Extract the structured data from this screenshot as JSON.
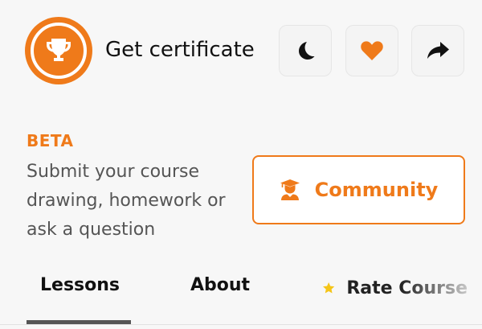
{
  "header": {
    "title": "Get certificate",
    "badge_icon": "trophy-icon",
    "actions": [
      {
        "icon": "moon-icon"
      },
      {
        "icon": "heart-icon"
      },
      {
        "icon": "share-icon"
      }
    ]
  },
  "beta": {
    "label": "BETA",
    "description": "Submit your course drawing, homework or ask a question"
  },
  "community_button": {
    "label": "Community",
    "icon": "graduate-user-icon"
  },
  "tabs": [
    {
      "label": "Lessons",
      "active": true
    },
    {
      "label": "About",
      "active": false
    },
    {
      "label": "Rate Course",
      "icon": "star-icon",
      "active": false
    }
  ],
  "colors": {
    "accent": "#ef7a1a",
    "star": "#f5c518",
    "background": "#f7f7f7"
  }
}
